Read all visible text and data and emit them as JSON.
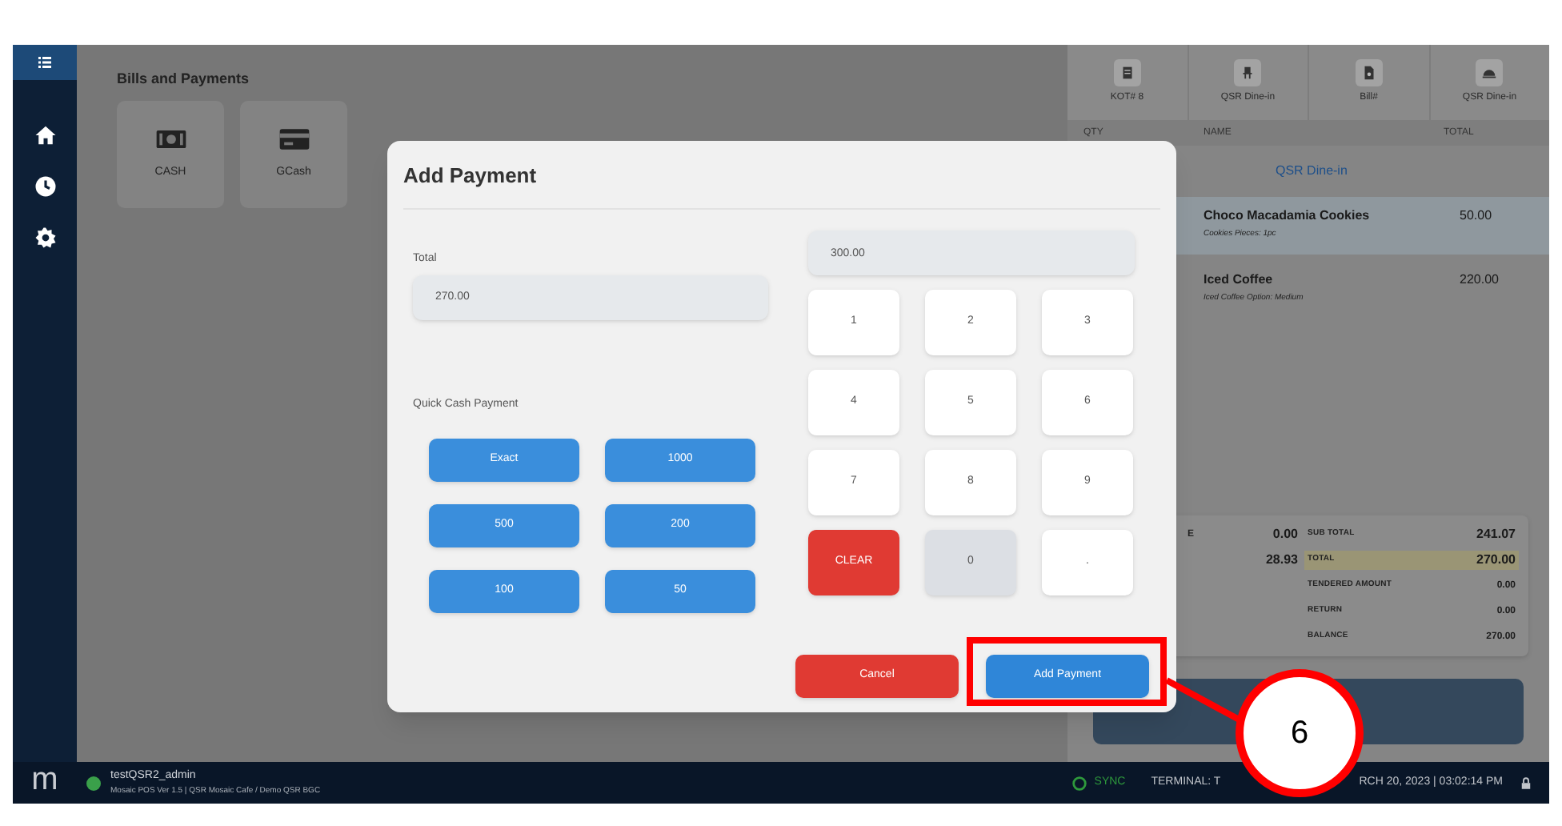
{
  "sidebar": {
    "items": [
      {
        "kind": "menu",
        "selected": true
      },
      {
        "kind": "home",
        "selected": false
      },
      {
        "kind": "history",
        "selected": false
      },
      {
        "kind": "settings",
        "selected": false
      }
    ]
  },
  "bills_and_payments": {
    "title": "Bills and Payments",
    "methods": [
      {
        "kind": "cash",
        "label": "CASH"
      },
      {
        "kind": "card",
        "label": "GCash"
      }
    ]
  },
  "order_panel": {
    "tabs": [
      {
        "kind": "kot",
        "label": "KOT# 8"
      },
      {
        "kind": "table",
        "label": "QSR Dine-in"
      },
      {
        "kind": "bill",
        "label": "Bill#"
      },
      {
        "kind": "dine",
        "label": "QSR Dine-in"
      }
    ],
    "columns": [
      "QTY",
      "NAME",
      "TOTAL"
    ],
    "section": "QSR Dine-in",
    "items": [
      {
        "name": "Choco Macadamia Cookies",
        "detail": "Cookies Pieces: 1pc",
        "total": "50.00",
        "selected": true
      },
      {
        "name": "Iced Coffee",
        "detail": "Iced Coffee Option: Medium",
        "total": "220.00",
        "selected": false
      }
    ],
    "summary_left": [
      {
        "label": "E",
        "value": "0.00"
      },
      {
        "value": "28.93"
      }
    ],
    "summary": [
      {
        "label": "SUB TOTAL",
        "value": "241.07",
        "selected": false
      },
      {
        "label": "TOTAL",
        "value": "270.00",
        "selected": true
      },
      {
        "label": "TENDERED AMOUNT",
        "value": "0.00",
        "selected": false
      },
      {
        "label": "RETURN",
        "value": "0.00",
        "selected": false
      },
      {
        "label": "BALANCE",
        "value": "270.00",
        "selected": false
      }
    ]
  },
  "status_bar": {
    "logo": "m",
    "online": true,
    "user": "testQSR2_admin",
    "info": "Mosaic POS Ver 1.5 | QSR Mosaic Cafe / Demo QSR BGC",
    "sync": "SYNC",
    "terminal": "TERMINAL: T",
    "datetime": "RCH 20, 2023 | 03:02:14 PM"
  },
  "dialog": {
    "title": "Add Payment",
    "total_label": "Total",
    "total_value": "270.00",
    "amount_value": "300.00",
    "quick_label": "Quick Cash Payment",
    "quick_buttons": [
      "Exact",
      "1000",
      "500",
      "200",
      "100",
      "50"
    ],
    "keys": [
      {
        "label": "1",
        "kind": "number",
        "pressed": false
      },
      {
        "label": "2",
        "kind": "number",
        "pressed": false
      },
      {
        "label": "3",
        "kind": "number",
        "pressed": false
      },
      {
        "label": "4",
        "kind": "number",
        "pressed": false
      },
      {
        "label": "5",
        "kind": "number",
        "pressed": false
      },
      {
        "label": "6",
        "kind": "number",
        "pressed": false
      },
      {
        "label": "7",
        "kind": "number",
        "pressed": false
      },
      {
        "label": "8",
        "kind": "number",
        "pressed": false
      },
      {
        "label": "9",
        "kind": "number",
        "pressed": false
      },
      {
        "label": "CLEAR",
        "kind": "clear",
        "pressed": false
      },
      {
        "label": "0",
        "kind": "number",
        "pressed": true
      },
      {
        "label": ".",
        "kind": "number",
        "pressed": false
      }
    ],
    "cancel": "Cancel",
    "submit": "Add Payment"
  },
  "annotation": {
    "label": "6"
  }
}
